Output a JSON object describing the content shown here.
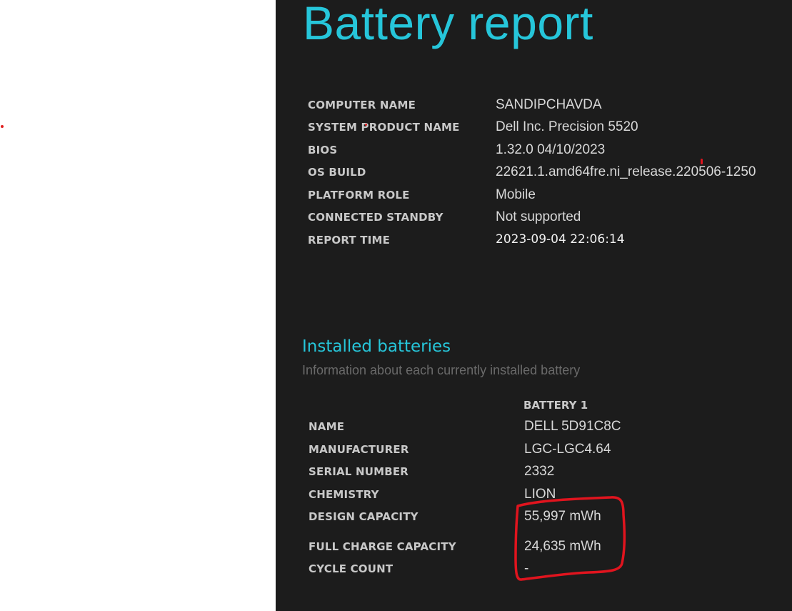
{
  "report": {
    "title": "Battery report",
    "system_info": [
      {
        "label": "COMPUTER NAME",
        "value": "SANDIPCHAVDA"
      },
      {
        "label": "SYSTEM PRODUCT NAME",
        "value": "Dell Inc. Precision 5520"
      },
      {
        "label": "BIOS",
        "value": "1.32.0 04/10/2023"
      },
      {
        "label": "OS BUILD",
        "value": "22621.1.amd64fre.ni_release.220506-1250"
      },
      {
        "label": "PLATFORM ROLE",
        "value": "Mobile"
      },
      {
        "label": "CONNECTED STANDBY",
        "value": "Not supported"
      },
      {
        "label": "REPORT TIME",
        "value": "2023-09-04  22:06:14"
      }
    ]
  },
  "installed_batteries": {
    "title": "Installed batteries",
    "subtitle": "Information about each currently installed battery",
    "column_header": "BATTERY 1",
    "rows": [
      {
        "label": "NAME",
        "value": "DELL 5D91C8C"
      },
      {
        "label": "MANUFACTURER",
        "value": "LGC-LGC4.64"
      },
      {
        "label": "SERIAL NUMBER",
        "value": "2332"
      },
      {
        "label": "CHEMISTRY",
        "value": "LION"
      },
      {
        "label": "DESIGN CAPACITY",
        "value": "55,997 mWh"
      },
      {
        "label": "FULL CHARGE CAPACITY",
        "value": "24,635 mWh"
      },
      {
        "label": "CYCLE COUNT",
        "value": "-"
      }
    ]
  },
  "colors": {
    "background": "#1c1c1c",
    "accent": "#26c6da",
    "annotation": "#e0141e"
  }
}
